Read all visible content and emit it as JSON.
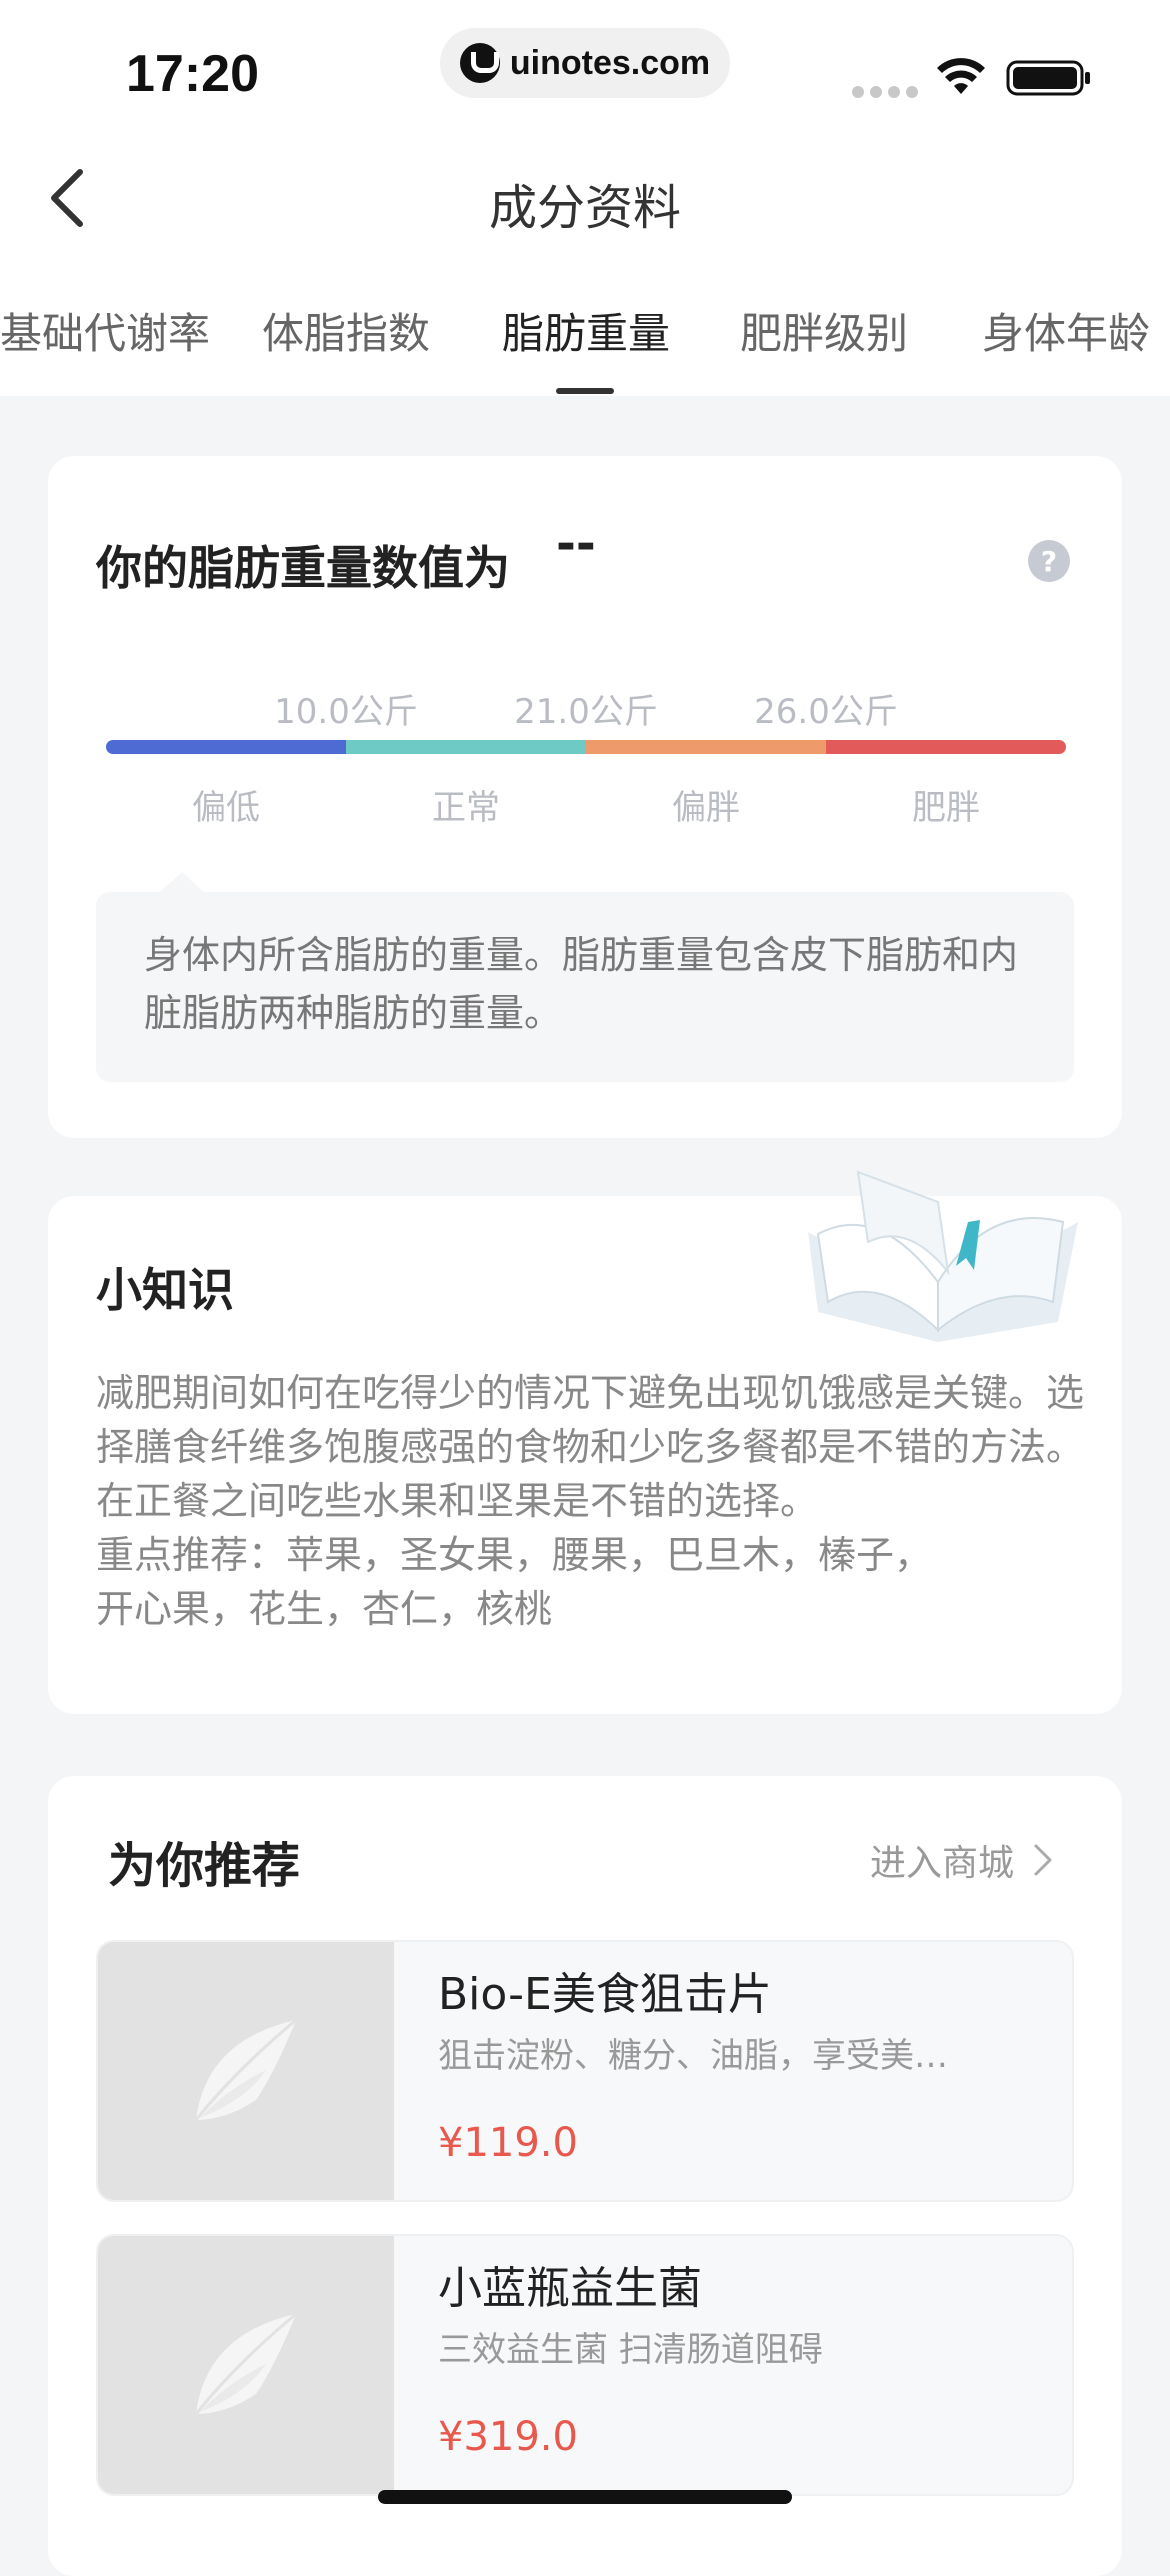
{
  "status_bar": {
    "time": "17:20",
    "url": "uinotes.com"
  },
  "nav": {
    "title": "成分资料"
  },
  "tabs": [
    {
      "label": "基础代谢率",
      "active": false
    },
    {
      "label": "体脂指数",
      "active": false
    },
    {
      "label": "脂肪重量",
      "active": true
    },
    {
      "label": "肥胖级别",
      "active": false
    },
    {
      "label": "身体年龄",
      "active": false
    }
  ],
  "fat_card": {
    "title": "你的脂肪重量数值为",
    "value": "--",
    "help": "?",
    "thresholds": [
      "10.0公斤",
      "21.0公斤",
      "26.0公斤"
    ],
    "ranges": [
      "偏低",
      "正常",
      "偏胖",
      "肥胖"
    ],
    "range_colors": [
      "#4e6bd4",
      "#6ecac4",
      "#ef9a6a",
      "#e25a5a"
    ],
    "description": "身体内所含脂肪的重量。脂肪重量包含皮下脂肪和内脏脂肪两种脂肪的重量。"
  },
  "tips_card": {
    "title": "小知识",
    "text": "减肥期间如何在吃得少的情况下避免出现饥饿感是关键。选择膳食纤维多饱腹感强的食物和少吃多餐都是不错的方法。在正餐之间吃些水果和坚果是不错的选择。",
    "recommend_line1": "重点推荐：苹果，圣女果，腰果，巴旦木，榛子，",
    "recommend_line2": "开心果，花生，杏仁，核桃"
  },
  "recommend": {
    "title": "为你推荐",
    "shop_link": "进入商城",
    "products": [
      {
        "name": "Bio-E美食狙击片",
        "desc": "狙击淀粉、糖分、油脂，享受美食无负担",
        "price": "¥119.0"
      },
      {
        "name": "小蓝瓶益生菌",
        "desc": "三效益生菌 扫清肠道阻碍",
        "price": "¥319.0"
      }
    ]
  },
  "colors": {
    "accent_price": "#e8584c",
    "background": "#f4f5f7"
  }
}
